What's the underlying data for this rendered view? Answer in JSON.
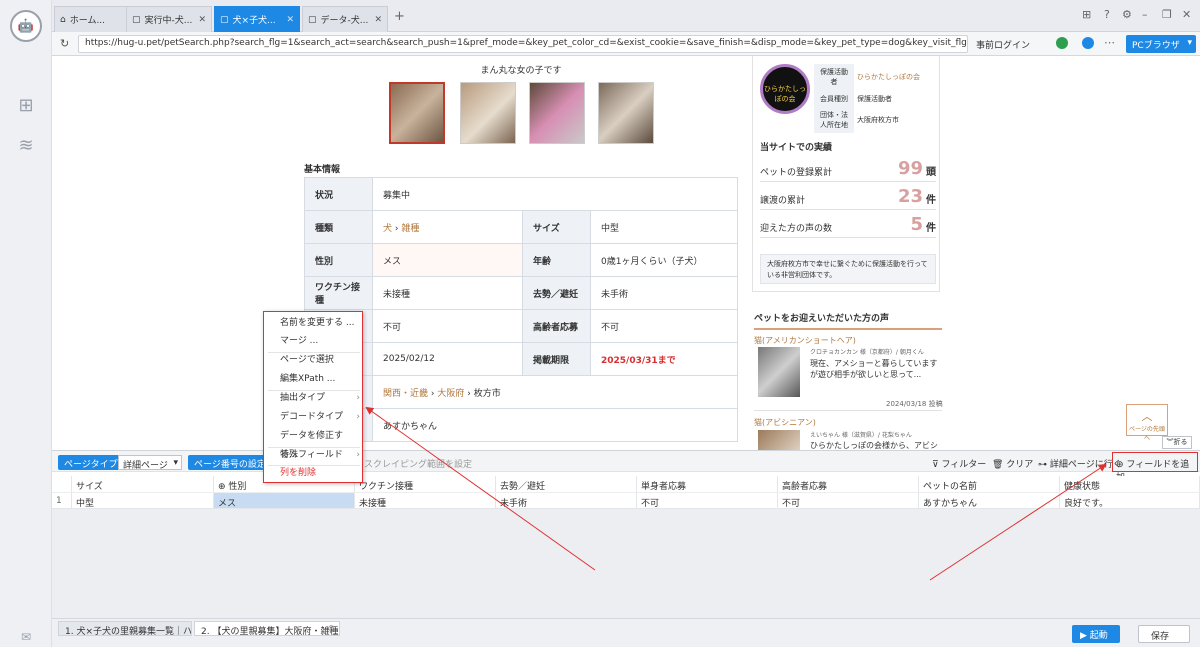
{
  "tabs": [
    {
      "label": "ホーム..."
    },
    {
      "label": "実行中-犬..."
    },
    {
      "label": "犬×子犬..."
    },
    {
      "label": "データ-犬..."
    }
  ],
  "address": {
    "url": "https://hug-u.pet/petSearch.php?search_flg=1&search_act=search&search_push=1&pref_mode=&key_pet_color_cd=&exist_cookie=&save_finish=&disp_mode=&key_pet_type=dog&key_visit_flg=on...",
    "login": "事前ログイン",
    "browser": "PCブラウザ"
  },
  "page": {
    "subtitle": "まん丸な女の子です",
    "section_title": "基本情報",
    "rows": {
      "status_label": "状況",
      "status_value": "募集中",
      "kind_label": "種類",
      "kind_dog": "犬",
      "kind_mix": "雑種",
      "size_label": "サイズ",
      "size_value": "中型",
      "sex_label": "性別",
      "sex_value": "メス",
      "age_label": "年齢",
      "age_value": "0歳1ヶ月くらい（子犬）",
      "vaccine_label": "ワクチン接種",
      "vaccine_value": "未接種",
      "neuter_label": "去勢／避妊",
      "neuter_value": "未手術",
      "single_value": "不可",
      "elderly_label": "高齢者応募",
      "elderly_value": "不可",
      "date_value": "2025/02/12",
      "deadline_label": "掲載期限",
      "deadline_value": "2025/03/31まで",
      "area_1": "関西・近畿",
      "area_2": "大阪府",
      "area_3": "枚方市",
      "name_value": "あすかちゃん"
    }
  },
  "sidebar": {
    "org_rows": [
      {
        "label": "保護活動者",
        "value": "ひらかたしっぽの会"
      },
      {
        "label": "会員種別",
        "value": "保護活動者"
      },
      {
        "label": "団体・法人所在地",
        "value": "大阪府枚方市"
      }
    ],
    "logo_text": "ひらかたしっぽの会",
    "record_title": "当サイトでの実績",
    "stats": [
      {
        "label": "ペットの登録累計",
        "value": "99",
        "unit": "頭"
      },
      {
        "label": "譲渡の累計",
        "value": "23",
        "unit": "件"
      },
      {
        "label": "迎えた方の声の数",
        "value": "5",
        "unit": "件"
      }
    ],
    "org_desc": "大阪府枚方市で幸せに繋ぐために保護活動を行っている非営利団体です。",
    "voice_title": "ペットをお迎えいただいた方の声",
    "voice1_type": "猫(アメリカンショートヘア)",
    "voice1_author": "クロチョカンカン 様（京都府）/ 朝月くん",
    "voice1_text": "現在、アメショーと暮らしていますが遊び相手が欲しいと思って...",
    "voice1_date": "2024/03/18 投稿",
    "voice2_type": "猫(アビシニアン)",
    "voice2_author": "えいちゃん 様（滋賀県）/ 花梨ちゃん",
    "voice2_text": "ひらかたしっぽの会様から、アビシニ",
    "top_btn": "ページの先頭へ",
    "fold": "折る"
  },
  "context_menu": {
    "rename": "名前を変更する ...",
    "merge": "マージ ...",
    "select_page": "ページで選択",
    "edit_xpath": "編集XPath ...",
    "extract_type": "抽出タイプ",
    "decode_type": "デコードタイプ",
    "modify_data": "データを修正する...",
    "special_field": "特殊フィールド",
    "delete_column": "列を削除"
  },
  "panel": {
    "page_type_btn": "ページタイプ",
    "page_type_value": "詳細ページ",
    "page_num_btn": "ページ番号の設定",
    "scrape_range": "スクレイピング範囲を設定",
    "filter": "フィルター",
    "clear": "クリア",
    "goto_detail": "詳細ページに行く",
    "add_field": "フィールドを追加",
    "columns": [
      "サイズ",
      "性別",
      "ワクチン接種",
      "去勢／避妊",
      "単身者応募",
      "高齢者応募",
      "ペットの名前",
      "健康状態"
    ],
    "row_num": "1",
    "row": [
      "中型",
      "メス",
      "未接種",
      "未手術",
      "不可",
      "不可",
      "あすかちゃん",
      "良好です。"
    ]
  },
  "bottom": {
    "tab1": "1. 犬×子犬の里親募集一覧｜ハグ...",
    "tab2": "2. 【犬の里親募集】大阪府・雑種...",
    "run": "起動",
    "save": "保存"
  }
}
